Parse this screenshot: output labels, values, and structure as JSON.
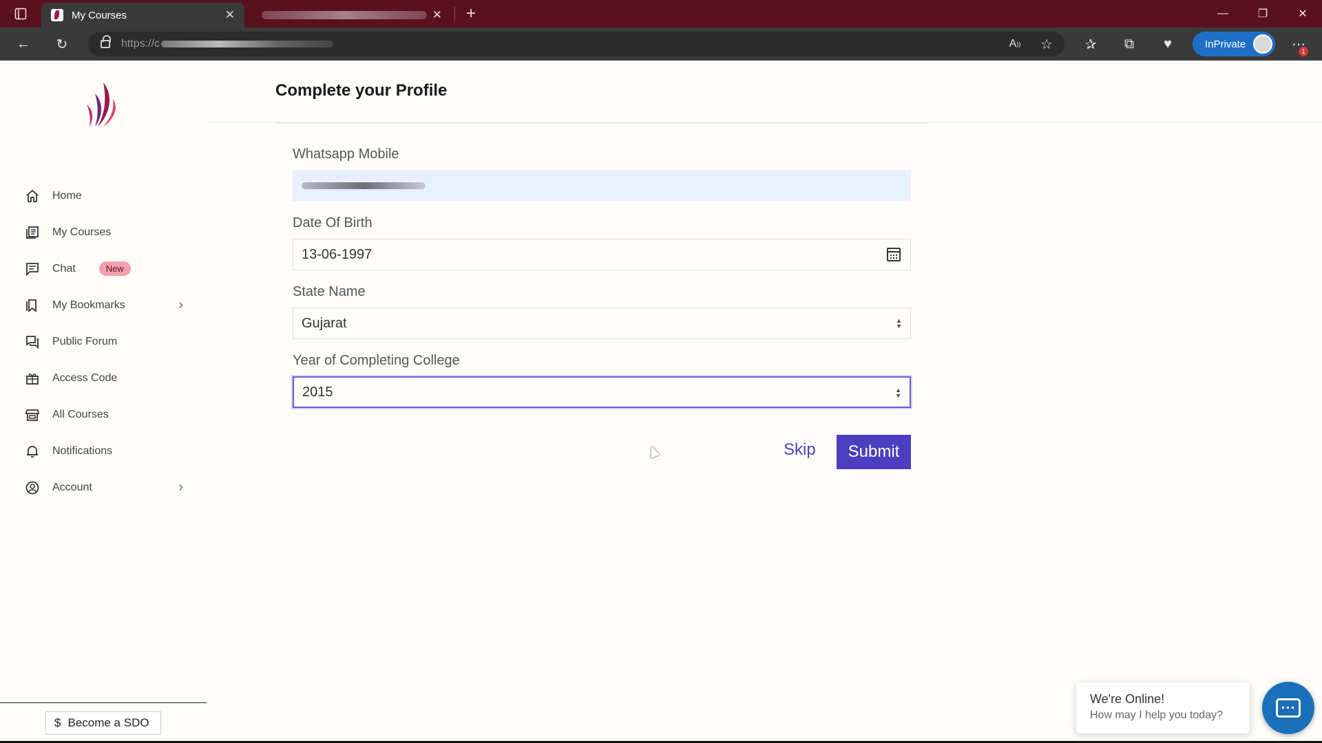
{
  "browser": {
    "active_tab_title": "My Courses",
    "address_prefix": "https://c",
    "inprivate_label": "InPrivate",
    "notification_count": "1"
  },
  "sidebar": {
    "items": [
      {
        "label": "Home",
        "icon": "home-icon"
      },
      {
        "label": "My Courses",
        "icon": "courses-icon"
      },
      {
        "label": "Chat",
        "icon": "chat-icon",
        "badge": "New"
      },
      {
        "label": "My Bookmarks",
        "icon": "bookmark-icon",
        "has_chevron": true
      },
      {
        "label": "Public Forum",
        "icon": "forum-icon"
      },
      {
        "label": "Access Code",
        "icon": "gift-icon"
      },
      {
        "label": "All Courses",
        "icon": "store-icon"
      },
      {
        "label": "Notifications",
        "icon": "bell-icon"
      },
      {
        "label": "Account",
        "icon": "user-circle-icon",
        "has_chevron": true
      }
    ],
    "become_label": "Become a SDO",
    "become_symbol": "$"
  },
  "main": {
    "title": "Complete your Profile",
    "fields": {
      "whatsapp_label": "Whatsapp Mobile",
      "dob_label": "Date Of Birth",
      "dob_value": "13-06-1997",
      "state_label": "State Name",
      "state_value": "Gujarat",
      "year_label": "Year of Completing College",
      "year_value": "2015"
    },
    "skip_label": "Skip",
    "submit_label": "Submit"
  },
  "chat_widget": {
    "line1": "We're Online!",
    "line2": "How may I help you today?"
  },
  "colors": {
    "tabbar": "#5a111e",
    "toolbar": "#3a3a3a",
    "accent": "#4b3fbf",
    "inprivate": "#1f6fc7",
    "chat_launcher": "#1b6fb8",
    "new_badge": "#f4a0ae"
  }
}
